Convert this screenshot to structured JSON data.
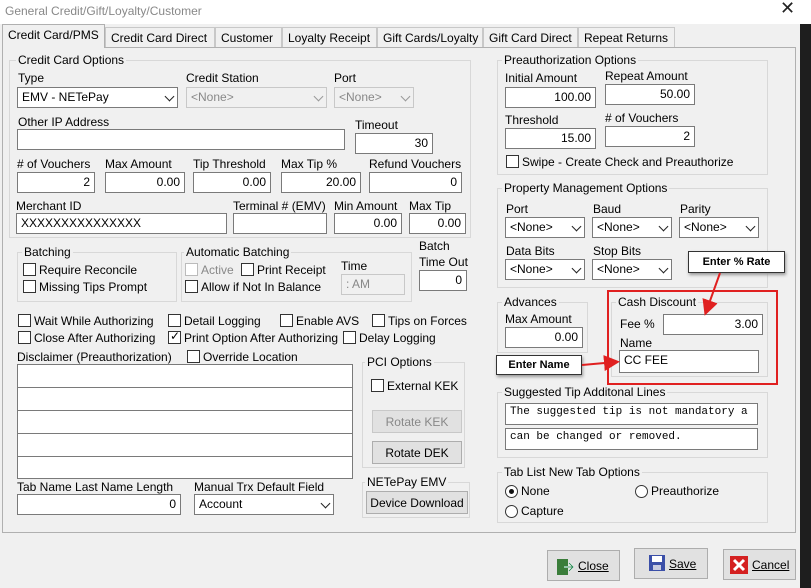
{
  "window": {
    "title": "General Credit/Gift/Loyalty/Customer",
    "close_glyph": "✕"
  },
  "tabs": [
    "Credit Card/PMS",
    "Credit Card Direct",
    "Customer",
    "Loyalty Receipt",
    "Gift Cards/Loyalty",
    "Gift Card Direct",
    "Repeat Returns"
  ],
  "cc": {
    "title": "Credit Card Options",
    "type_label": "Type",
    "type_value": "EMV - NETePay",
    "station_label": "Credit Station",
    "station_value": "<None>",
    "port_label": "Port",
    "port_value": "<None>",
    "other_ip_label": "Other IP Address",
    "other_ip_value": "",
    "timeout_label": "Timeout",
    "timeout_value": "30",
    "vouchers_label": "# of Vouchers",
    "vouchers_value": "2",
    "max_amount_label": "Max Amount",
    "max_amount_value": "0.00",
    "tip_threshold_label": "Tip Threshold",
    "tip_threshold_value": "0.00",
    "max_tip_pct_label": "Max Tip %",
    "max_tip_pct_value": "20.00",
    "refund_vouchers_label": "Refund Vouchers",
    "refund_vouchers_value": "0",
    "merchant_label": "Merchant ID",
    "merchant_value": "XXXXXXXXXXXXXXX",
    "terminal_label": "Terminal # (EMV)",
    "terminal_value": "",
    "min_amount_label": "Min Amount",
    "min_amount_value": "0.00",
    "max_tip_label": "Max Tip",
    "max_tip_value": "0.00"
  },
  "batching": {
    "title": "Batching",
    "require_reconcile": "Require Reconcile",
    "missing_tips": "Missing Tips Prompt"
  },
  "auto_batching": {
    "title": "Automatic Batching",
    "active": "Active",
    "print_receipt": "Print Receipt",
    "allow_not_balance": "Allow if Not In Balance",
    "time_label": "Time",
    "time_value": ":  AM"
  },
  "batch_timeout": {
    "label_line1": "Batch",
    "label_line2": "Time Out",
    "value": "0"
  },
  "options": {
    "wait_while_auth": "Wait While Authorizing",
    "detail_logging": "Detail Logging",
    "enable_avs": "Enable AVS",
    "tips_on_forces": "Tips on Forces",
    "close_after_auth": "Close After Authorizing",
    "print_option_after_auth": "Print Option After Authorizing",
    "delay_logging": "Delay Logging",
    "check_glyph": "✓"
  },
  "disclaimer": {
    "label": "Disclaimer (Preauthorization)",
    "override_location": "Override Location"
  },
  "pci": {
    "title": "PCI Options",
    "external_kek": "External KEK",
    "rotate_kek": "Rotate KEK",
    "rotate_dek": "Rotate DEK"
  },
  "tab_name": {
    "label": "Tab Name  Last Name Length",
    "value": "0"
  },
  "manual_trx": {
    "label": "Manual Trx Default Field",
    "value": "Account"
  },
  "netepay": {
    "title": "NETePay EMV",
    "device_download": "Device Download"
  },
  "preauth": {
    "title": "Preauthorization Options",
    "initial_label": "Initial Amount",
    "initial_value": "100.00",
    "repeat_label": "Repeat Amount",
    "repeat_value": "50.00",
    "threshold_label": "Threshold",
    "threshold_value": "15.00",
    "vouchers_label": "# of Vouchers",
    "vouchers_value": "2",
    "swipe_label": "Swipe - Create Check and Preauthorize"
  },
  "pms": {
    "title": "Property Management Options",
    "port_label": "Port",
    "baud_label": "Baud",
    "parity_label": "Parity",
    "databits_label": "Data Bits",
    "stopbits_label": "Stop Bits",
    "none": "<None>"
  },
  "advances": {
    "title": "Advances",
    "max_amount_label": "Max Amount",
    "max_amount_value": "0.00"
  },
  "cash_discount": {
    "title": "Cash Discount",
    "fee_label": "Fee %",
    "fee_value": "3.00",
    "name_label": "Name",
    "name_value": "CC FEE"
  },
  "callouts": {
    "rate": "Enter % Rate",
    "name": "Enter Name",
    "accent": "#e02020"
  },
  "suggested": {
    "title": "Suggested Tip Additonal Lines",
    "line1": "The suggested tip is not mandatory a",
    "line2": "can be changed or removed."
  },
  "tablist": {
    "title": "Tab List New Tab Options",
    "none": "None",
    "preauthorize": "Preauthorize",
    "capture": "Capture"
  },
  "buttons": {
    "close": "Close",
    "save": "Save",
    "cancel": "Cancel"
  }
}
